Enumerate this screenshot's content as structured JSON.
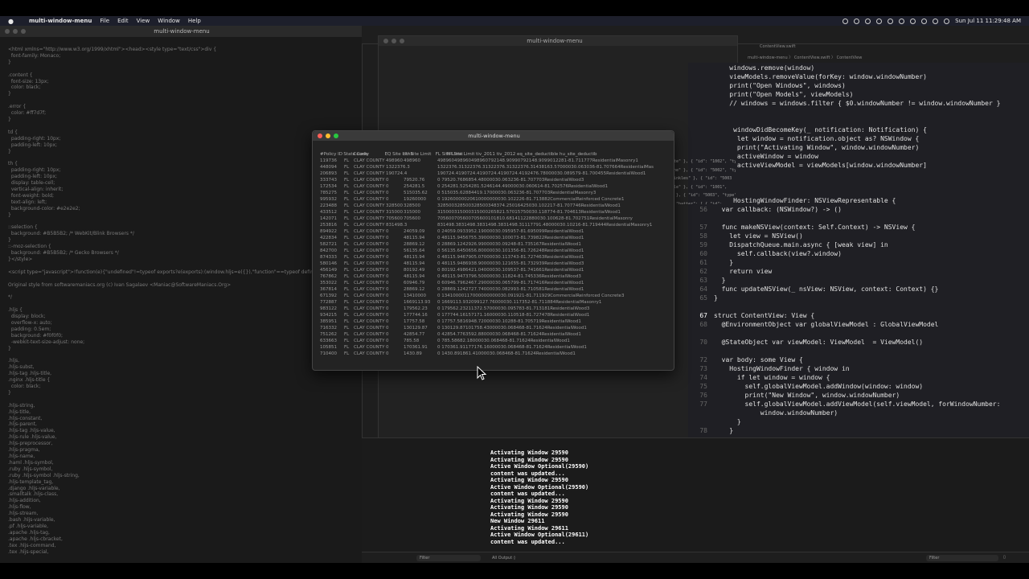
{
  "menubar": {
    "app_name": "multi-window-menu",
    "items": [
      "File",
      "Edit",
      "View",
      "Window",
      "Help"
    ],
    "clock": "Sun Jul 11  11:29:48 AM"
  },
  "left_window": {
    "title": "multi-window-menu",
    "code": "<html xmlns=\"http://www.w3.org/1999/xhtml\"><head><style type=\"text/css\">div {\n  font-family: Monaco;\n}\n\n.content {\n  font-size: 13px;\n  color: black;\n}\n\n.error {\n  color: #ff7d7f;\n}\n\ntd {\n  padding-right: 10px;\n  padding-left: 10px;\n}\n\nth {\n  padding-right: 10px;\n  padding-left: 10px;\n  display: table-cell;\n  vertical-align: inherit;\n  font-weight: bold;\n  text-align: left;\n  background-color: #e2e2e2;\n}\n\n::selection {\n  background: #B5B5B2; /* WebKit/Blink Browsers */\n}\n::-moz-selection {\n  background: #B5B5B2; /* Gecko Browsers */\n}</style>\n\n<script type=\"javascript\">!function(e){\"undefined\"!=typeof exports?e(exports):(window.hljs=e({}),\"function\"==typeof define\n\nOriginal style from softwaremaniacs.org (c) Ivan Sagalaev <Maniac@SoftwareManiacs.Org>\n\n*/\n\n.hljs {\n  display: block;\n  overflow-x: auto;\n  padding: 0.5em;\n  background: #f0f0f0;\n  -webkit-text-size-adjust: none;\n}\n\n.hljs,\n.hljs-subst,\n.hljs-tag .hljs-title,\n.nginx .hljs-title {\n  color: black;\n}\n\n.hljs-string,\n.hljs-title,\n.hljs-constant,\n.hljs-parent,\n.hljs-tag .hljs-value,\n.hljs-rule .hljs-value,\n.hljs-preprocessor,\n.hljs-pragma,\n.hljs-name,\n.haml .hljs-symbol,\n.ruby .hljs-symbol,\n.ruby .hljs-symbol .hljs-string,\n.hljs-template_tag,\n.django .hljs-variable,\n.smalltalk .hljs-class,\n.hljs-addition,\n.hljs-flow,\n.hljs-stream,\n.bash .hljs-variable,\n.pf .hljs-variable,\n.apache .hljs-tag,\n.apache .hljs-cbracket,\n.tex .hljs-command,\n.tex .hljs-special,"
  },
  "middle_window": {
    "title": "multi-window-menu",
    "tab": "Running multi-window-menu : multi-window-menu"
  },
  "xcode": {
    "file_tab": "ContentView.swift",
    "breadcrumbs": "multi-window-menu  〉 ContentView.swift  〉 ContentView",
    "json_peek": "ate\" }, { \"id\": \"1002\", \"ty\none\" }, { \"id\": \"5002\", \"ty\nrinkles\" }, { \"id\": \"5003\nple\" }, { \"id\": \"1001\",\n\" }, { \"id\": \"5003\", \"type\":\n{ \"batter\": [ { \"id\":\n\"Glazed\" }, { \"id\":",
    "lines": [
      {
        "n": "",
        "t": "    windows.remove(window)"
      },
      {
        "n": "",
        "t": "    viewModels.removeValue(forKey: window.windowNumber)"
      },
      {
        "n": "",
        "t": "    print(\"Open Windows\", windows)"
      },
      {
        "n": "",
        "t": "    print(\"Open Models\", viewModels)"
      },
      {
        "n": "",
        "t": "    // windows = windows.filter { $0.windowNumber != window.windowNumber }"
      },
      {
        "n": "",
        "t": ""
      },
      {
        "n": "",
        "t": ""
      },
      {
        "n": "",
        "t": "     windowDidBecomeKey(_ notification: Notification) {"
      },
      {
        "n": "",
        "t": "      let window = notification.object as? NSWindow {"
      },
      {
        "n": "",
        "t": "      print(\"Activating Window\", window.windowNumber)"
      },
      {
        "n": "",
        "t": "      activeWindow = window"
      },
      {
        "n": "",
        "t": "      activeViewModel = viewModels[window.windowNumber]"
      },
      {
        "n": "",
        "t": ""
      },
      {
        "n": "",
        "t": ""
      },
      {
        "n": "",
        "t": ""
      },
      {
        "n": "",
        "t": "     HostingWindowFinder: NSViewRepresentable {"
      },
      {
        "n": "56",
        "t": "  var callback: (NSWindow?) -> ()"
      },
      {
        "n": "",
        "t": ""
      },
      {
        "n": "57",
        "t": "  func makeNSView(context: Self.Context) -> NSView {"
      },
      {
        "n": "58",
        "t": "    let view = NSView()"
      },
      {
        "n": "59",
        "t": "    DispatchQueue.main.async { [weak view] in"
      },
      {
        "n": "60",
        "t": "      self.callback(view?.window)"
      },
      {
        "n": "61",
        "t": "    }"
      },
      {
        "n": "62",
        "t": "    return view"
      },
      {
        "n": "63",
        "t": "  }"
      },
      {
        "n": "64",
        "t": "  func updateNSView(_ nsView: NSView, context: Context) {}"
      },
      {
        "n": "65",
        "t": "}"
      },
      {
        "n": "",
        "t": ""
      },
      {
        "n": "67",
        "t": "struct ContentView: View {"
      },
      {
        "n": "68",
        "t": "  @EnvironmentObject var globalViewModel : GlobalViewModel"
      },
      {
        "n": "",
        "t": ""
      },
      {
        "n": "70",
        "t": "  @StateObject var viewModel: ViewModel  = ViewModel()"
      },
      {
        "n": "",
        "t": ""
      },
      {
        "n": "72",
        "t": "  var body: some View {"
      },
      {
        "n": "73",
        "t": "    HostingWindowFinder { window in"
      },
      {
        "n": "74",
        "t": "      if let window = window {"
      },
      {
        "n": "75",
        "t": "        self.globalViewModel.addWindow(window: window)"
      },
      {
        "n": "76",
        "t": "        print(\"New Window\", window.windowNumber)"
      },
      {
        "n": "77",
        "t": "        self.globalViewModel.addViewModel(self.viewModel, forWindowNumber:"
      },
      {
        "n": "",
        "t": "            window.windowNumber)"
      },
      {
        "n": "",
        "t": "      }"
      },
      {
        "n": "78",
        "t": "    }"
      }
    ]
  },
  "console": {
    "log": "Activating Window 29590\nActivating Window 29590\nActive Window Optional(29590)\ncontent was updated...\nActivating Window 29590\nActive Window Optional(29590)\ncontent was updated...\nActivating Window 29590\nActivating Window 29590\nActivating Window 29590\nNew Window 29611\nActivating Window 29611\nActive Window Optional(29611)\ncontent was updated...",
    "filter_placeholder": "Filter",
    "output_selector": "All Output ◊",
    "filter_right_placeholder": "Filter"
  },
  "front_window": {
    "title": "multi-window-menu",
    "header": [
      "#Policy ID",
      "State Code",
      "County",
      "EQ Site Limit",
      "HU Site Limit",
      "FL Site Limit",
      "FR Site Limit tiv_2011 tiv_2012 eq_site_deductible hu_site_deductib"
    ],
    "rows": [
      [
        "119736",
        "FL",
        "CLAY COUNTY",
        "498960",
        "498960",
        "498960498960498960792148.90990792148.9099012281-81.711777ResidentialMasonry1"
      ],
      [
        "448094",
        "FL",
        "CLAY COUNTY",
        "1322376.3",
        "",
        "1322376.31322376.31322376.31322376.31438163.57000030.063036-81.707664ResidentialMas"
      ],
      [
        "206893",
        "FL",
        "CLAY COUNTY",
        "190724.4",
        "",
        "190724.4190724.4190724.4190724.4192476.78000030.089579-81.700455ResidentialWood1"
      ],
      [
        "333743",
        "FL",
        "CLAY COUNTY",
        "0",
        "79520.76",
        "0 79520.7686854.48000030.063236-81.707703ResidentialWood3"
      ],
      [
        "172534",
        "FL",
        "CLAY COUNTY",
        "0",
        "254281.5",
        "0 254281.5254281.5246144.49000030.060614-81.702576ResidentialWood1"
      ],
      [
        "785275",
        "FL",
        "CLAY COUNTY",
        "0",
        "515035.62",
        "0 515035.62884419.17000030.063236-81.707703ResidentialMasonry3"
      ],
      [
        "995932",
        "FL",
        "CLAY COUNTY",
        "0",
        "19260000",
        "0 19260000020610000000030.102226-81.713882CommercialReinforced Concrete1"
      ],
      [
        "223488",
        "FL",
        "CLAY COUNTY",
        "328500",
        "328500",
        "328500328500328500348374.25016425030.102217-81.707746ResidentialWood1"
      ],
      [
        "433512",
        "FL",
        "CLAY COUNTY",
        "315000",
        "315000",
        "315000315000315000265821.57015750030.118774-81.704613ResidentialWood1"
      ],
      [
        "142071",
        "FL",
        "CLAY COUNTY",
        "705600",
        "705600",
        "705600705600705600101810.68141122880030.100628-81.702751ResidentialMasonry"
      ],
      [
        "253816",
        "FL",
        "CLAY COUNTY",
        "831498.3",
        "",
        "831498.3831498.3831498.3831498.31117791.48000030.10216-81.719444ResidentialMasonry1"
      ],
      [
        "894922",
        "FL",
        "CLAY COUNTY",
        "0",
        "24059.09",
        "0 24059.0933952.19000030.095957-81.695099ResidentialWood1"
      ],
      [
        "422834",
        "FL",
        "CLAY COUNTY",
        "0",
        "48115.94",
        "0 48115.9456755.39000030.100073-81.739822ResidentialWood1"
      ],
      [
        "582721",
        "FL",
        "CLAY COUNTY",
        "0",
        "28869.12",
        "0 28869.1242926.99000030.09248-81.735167ResidentialWood1"
      ],
      [
        "842700",
        "FL",
        "CLAY COUNTY",
        "0",
        "56135.64",
        "0 56135.6450656.80000030.101356-81.726248ResidentialWood1"
      ],
      [
        "874333",
        "FL",
        "CLAY COUNTY",
        "0",
        "48115.94",
        "0 48115.9467905.07000030.113743-81.727463ResidentialWood1"
      ],
      [
        "580146",
        "FL",
        "CLAY COUNTY",
        "0",
        "48115.94",
        "0 48115.9486938.90000030.121655-81.732939ResidentialWood3"
      ],
      [
        "456149",
        "FL",
        "CLAY COUNTY",
        "0",
        "80192.49",
        "0 80192.4986421.04000030.109537-81.741661ResidentialWood1"
      ],
      [
        "767862",
        "FL",
        "CLAY COUNTY",
        "0",
        "48115.94",
        "0 48115.9473796.50000030.11824-81.745336ResidentialWood3"
      ],
      [
        "353022",
        "FL",
        "CLAY COUNTY",
        "0",
        "60946.79",
        "0 60946.7962467.29000030.065799-81.717416ResidentialWood1"
      ],
      [
        "367814",
        "FL",
        "CLAY COUNTY",
        "0",
        "28869.12",
        "0 28869.1242727.74000030.082993-81.710581ResidentialWood1"
      ],
      [
        "671392",
        "FL",
        "CLAY COUNTY",
        "0",
        "13410000",
        "0 13410000117000000000030.091921-81.711929CommercialReinforced Concrete3"
      ],
      [
        "772887",
        "FL",
        "CLAY COUNTY",
        "0",
        "1669113.93",
        "0 1669113.932099127.76000030.117352-81.711884ResidentialMasonry1"
      ],
      [
        "983122",
        "FL",
        "CLAY COUNTY",
        "0",
        "179562.23",
        "0 179562.23211372.57000030.095783-81.713181ResidentialWood3"
      ],
      [
        "934215",
        "FL",
        "CLAY COUNTY",
        "0",
        "177744.16",
        "0 177744.16157171.16000030.110518-81.727478ResidentialWood1"
      ],
      [
        "385951",
        "FL",
        "CLAY COUNTY",
        "0",
        "17757.58",
        "0 17757.5816948.72000030.10288-81.705719ResidentialWood1"
      ],
      [
        "716332",
        "FL",
        "CLAY COUNTY",
        "0",
        "130129.87",
        "0 130129.87101758.43000030.068468-81.71624ResidentialWood1"
      ],
      [
        "751262",
        "FL",
        "CLAY COUNTY",
        "0",
        "42854.77",
        "0 42854.7763592.88000030.068468-81.71624ResidentialWood1"
      ],
      [
        "633663",
        "FL",
        "CLAY COUNTY",
        "0",
        "785.58",
        "0 785.58682.18000030.068468-81.71624ResidentialWood1"
      ],
      [
        "105851",
        "FL",
        "CLAY COUNTY",
        "0",
        "170361.91",
        "0 170361.91177176.16000030.068468-81.71624ResidentialWood1"
      ],
      [
        "710400",
        "FL",
        "CLAY COUNTY",
        "0",
        "1430.89",
        "0 1430.891861.41000030.068468-81.71624ResidentialWood1"
      ]
    ]
  },
  "colors": {
    "accent_red": "#ff5f57",
    "accent_yellow": "#febc2e",
    "accent_green": "#28c840",
    "keyword": "#fc5fa3",
    "type": "#d0a8ff",
    "string": "#fc6a5d"
  }
}
